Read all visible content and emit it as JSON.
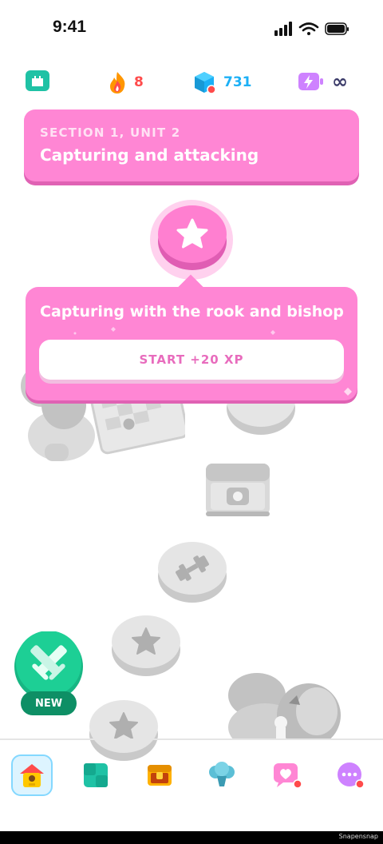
{
  "status_bar": {
    "time": "9:41"
  },
  "stats": {
    "streak": "8",
    "gems": "731",
    "energy": "∞"
  },
  "unit_banner": {
    "section": "SECTION 1, UNIT 2",
    "title": "Capturing and attacking"
  },
  "lesson_popover": {
    "title": "Capturing with the rook and bishop",
    "start_label": "START +20 XP"
  },
  "path": {
    "new_badge": "NEW"
  },
  "footer": {
    "watermark": "Snapensnap"
  },
  "colors": {
    "accent_pink": "#ff86d4",
    "streak_orange": "#ff9600",
    "gem_blue": "#1cb0f6",
    "energy_purple": "#ce82ff",
    "league_green": "#1fc2a5"
  }
}
